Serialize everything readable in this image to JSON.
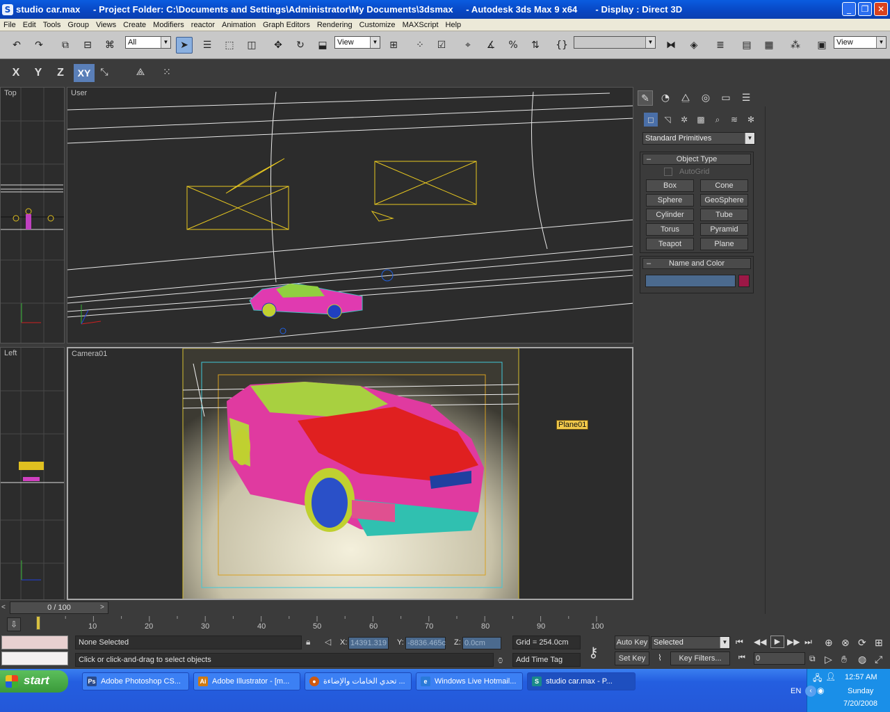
{
  "window": {
    "title": "studio car.max     - Project Folder: C:\\Documents and Settings\\Administrator\\My Documents\\3dsmax     - Autodesk 3ds Max 9 x64       - Display : Direct 3D",
    "app_icon": "3dsmax-icon"
  },
  "menu": [
    "File",
    "Edit",
    "Tools",
    "Group",
    "Views",
    "Create",
    "Modifiers",
    "reactor",
    "Animation",
    "Graph Editors",
    "Rendering",
    "Customize",
    "MAXScript",
    "Help"
  ],
  "toolbar": {
    "selection_filter": "All",
    "ref_coord": "View",
    "named_selection": "",
    "view_dropdown": "View"
  },
  "axis_constraints": [
    "X",
    "Y",
    "Z",
    "XY"
  ],
  "viewports": {
    "top": "Top",
    "user": "User",
    "left": "Left",
    "camera": "Camera01",
    "camera_tooltip": "Plane01"
  },
  "command_panel": {
    "category": "Standard Primitives",
    "object_type_title": "Object Type",
    "autogrid": "AutoGrid",
    "buttons": [
      "Box",
      "Cone",
      "Sphere",
      "GeoSphere",
      "Cylinder",
      "Tube",
      "Torus",
      "Pyramid",
      "Teapot",
      "Plane"
    ],
    "name_color_title": "Name and Color",
    "name_value": "",
    "color": "#9c1846"
  },
  "timeline": {
    "frame_display": "0 / 100",
    "current_frame": 0,
    "total_frames": 100,
    "ticks": [
      "10",
      "20",
      "30",
      "40",
      "50",
      "60",
      "70",
      "80",
      "90",
      "100"
    ]
  },
  "status": {
    "selection": "None Selected",
    "prompt": "Click or click-and-drag to select objects",
    "x_label": "X:",
    "x_value": "14391.319",
    "y_label": "Y:",
    "y_value": "-8836.465c",
    "z_label": "Z:",
    "z_value": "0.0cm",
    "grid": "Grid = 254.0cm",
    "add_time_tag": "Add Time Tag",
    "auto_key": "Auto Key",
    "set_key": "Set Key",
    "key_mode": "Selected",
    "key_filters": "Key Filters...",
    "frame_field": "0"
  },
  "taskbar": {
    "start": "start",
    "tasks": [
      {
        "label": "Adobe Photoshop CS...",
        "icon": "Ps",
        "color": "#2a4a8a"
      },
      {
        "label": "Adobe Illustrator - [m...",
        "icon": "Ai",
        "color": "#d07a10"
      },
      {
        "label": "تحدي الخامات والإضاءة ...",
        "icon": "ff",
        "color": "#d05a10"
      },
      {
        "label": "Windows Live Hotmail...",
        "icon": "ie",
        "color": "#2a7ad8"
      },
      {
        "label": "studio car.max     - P...",
        "icon": "3d",
        "color": "#1a8a8a"
      }
    ],
    "lang": "EN",
    "time": "12:57 AM",
    "day": "Sunday",
    "date": "7/20/2008"
  }
}
